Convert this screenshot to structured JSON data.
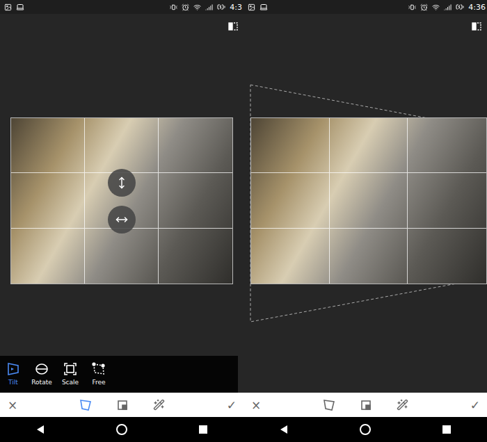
{
  "screens": [
    {
      "status_bar": {
        "time": "4:3"
      },
      "adjust_handles": true,
      "transform_outline": false,
      "tool_options": [
        {
          "label": "Tilt",
          "kind": "tilt",
          "selected": true
        },
        {
          "label": "Rotate",
          "kind": "rotate",
          "selected": false
        },
        {
          "label": "Scale",
          "kind": "scale",
          "selected": false
        },
        {
          "label": "Free",
          "kind": "free",
          "selected": false
        }
      ],
      "toolbar": {
        "cancel": "×",
        "confirm": "✓",
        "tools": [
          {
            "kind": "perspective",
            "selected": true
          },
          {
            "kind": "expand",
            "selected": false
          },
          {
            "kind": "details",
            "selected": false
          }
        ]
      }
    },
    {
      "status_bar": {
        "time": "4:36"
      },
      "adjust_handles": false,
      "transform_outline": true,
      "tool_options": [],
      "toolbar": {
        "cancel": "×",
        "confirm": "✓",
        "tools": [
          {
            "kind": "perspective",
            "selected": false
          },
          {
            "kind": "expand",
            "selected": false
          },
          {
            "kind": "details",
            "selected": false
          }
        ]
      }
    }
  ]
}
